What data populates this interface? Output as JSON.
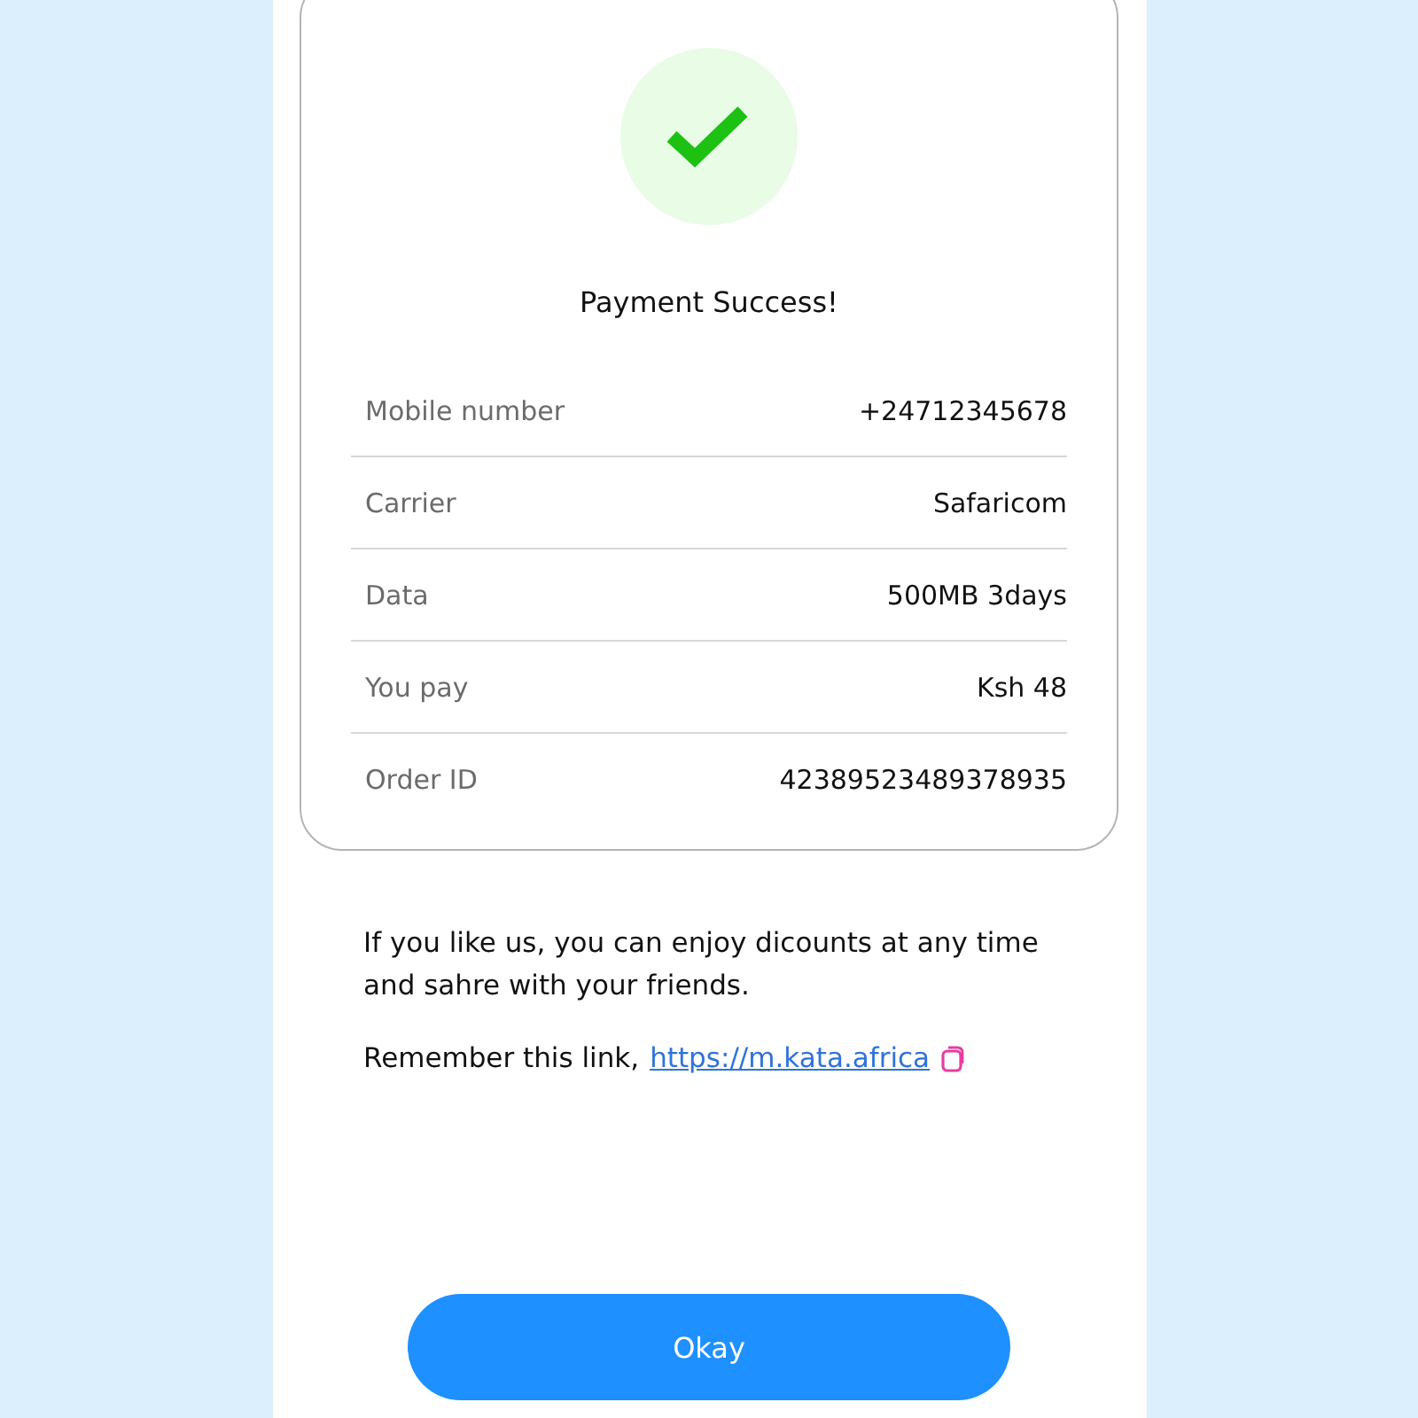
{
  "title": "Payment Success!",
  "details": [
    {
      "label": "Mobile number",
      "value": "+24712345678"
    },
    {
      "label": "Carrier",
      "value": "Safaricom"
    },
    {
      "label": "Data",
      "value": "500MB 3days"
    },
    {
      "label": "You pay",
      "value": "Ksh 48"
    },
    {
      "label": "Order ID",
      "value": "42389523489378935"
    }
  ],
  "message": "If you like us, you can enjoy dicounts at any time and sahre with your friends.",
  "link_prefix": "Remember this link,",
  "link": "https://m.kata.africa",
  "button": "Okay"
}
